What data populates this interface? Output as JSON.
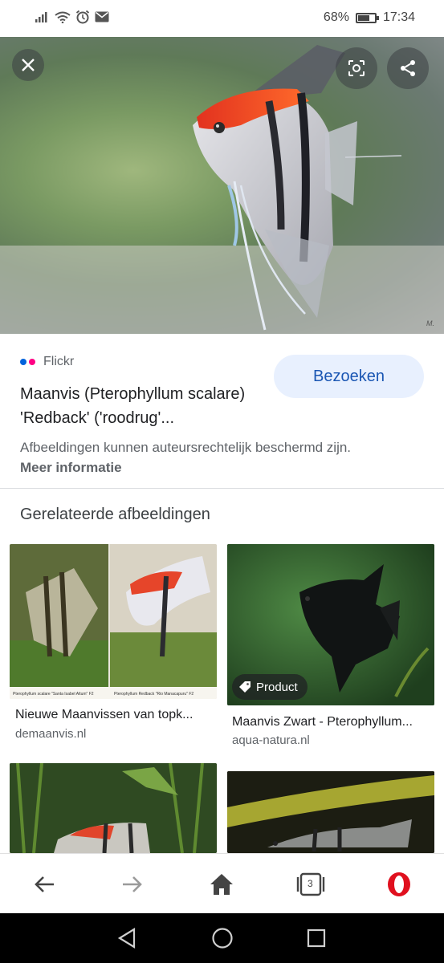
{
  "status_bar": {
    "battery_percent": "68%",
    "battery_level": 0.68,
    "time": "17:34"
  },
  "hero": {
    "close_icon": "close-icon",
    "lens_icon": "lens-search-icon",
    "share_icon": "share-icon",
    "watermark": "M."
  },
  "source": {
    "site_name": "Flickr",
    "title": "Maanvis (Pterophyllum scalare) 'Redback' ('roodrug'...",
    "visit_label": "Bezoeken",
    "copyright_note": "Afbeeldingen kunnen auteursrechtelijk beschermd zijn.",
    "more_info": "Meer informatie",
    "colors": {
      "flickr_blue": "#0063dc",
      "flickr_pink": "#ff0084",
      "visit_bg": "#e8f0fe",
      "visit_text": "#1a56b3"
    }
  },
  "related": {
    "heading": "Gerelateerde afbeeldingen",
    "items": [
      {
        "caption": "Nieuwe Maanvissen van topk...",
        "domain": "demaanvis.nl",
        "sub_labels": [
          "Pterophyllum scalare \"Santa Isabel Altum\" F2",
          "Pterophyllum Redback \"Rio Manacapuru\" F2"
        ]
      },
      {
        "caption": "Maanvis Zwart - Pterophyllum...",
        "domain": "aqua-natura.nl",
        "badge": "Product"
      },
      {
        "caption": "",
        "domain": ""
      },
      {
        "caption": "",
        "domain": ""
      }
    ]
  },
  "bottom_nav": {
    "tab_count": "3",
    "icons": [
      "back-arrow-icon",
      "forward-arrow-icon",
      "home-icon",
      "tabs-icon",
      "opera-logo-icon"
    ]
  }
}
